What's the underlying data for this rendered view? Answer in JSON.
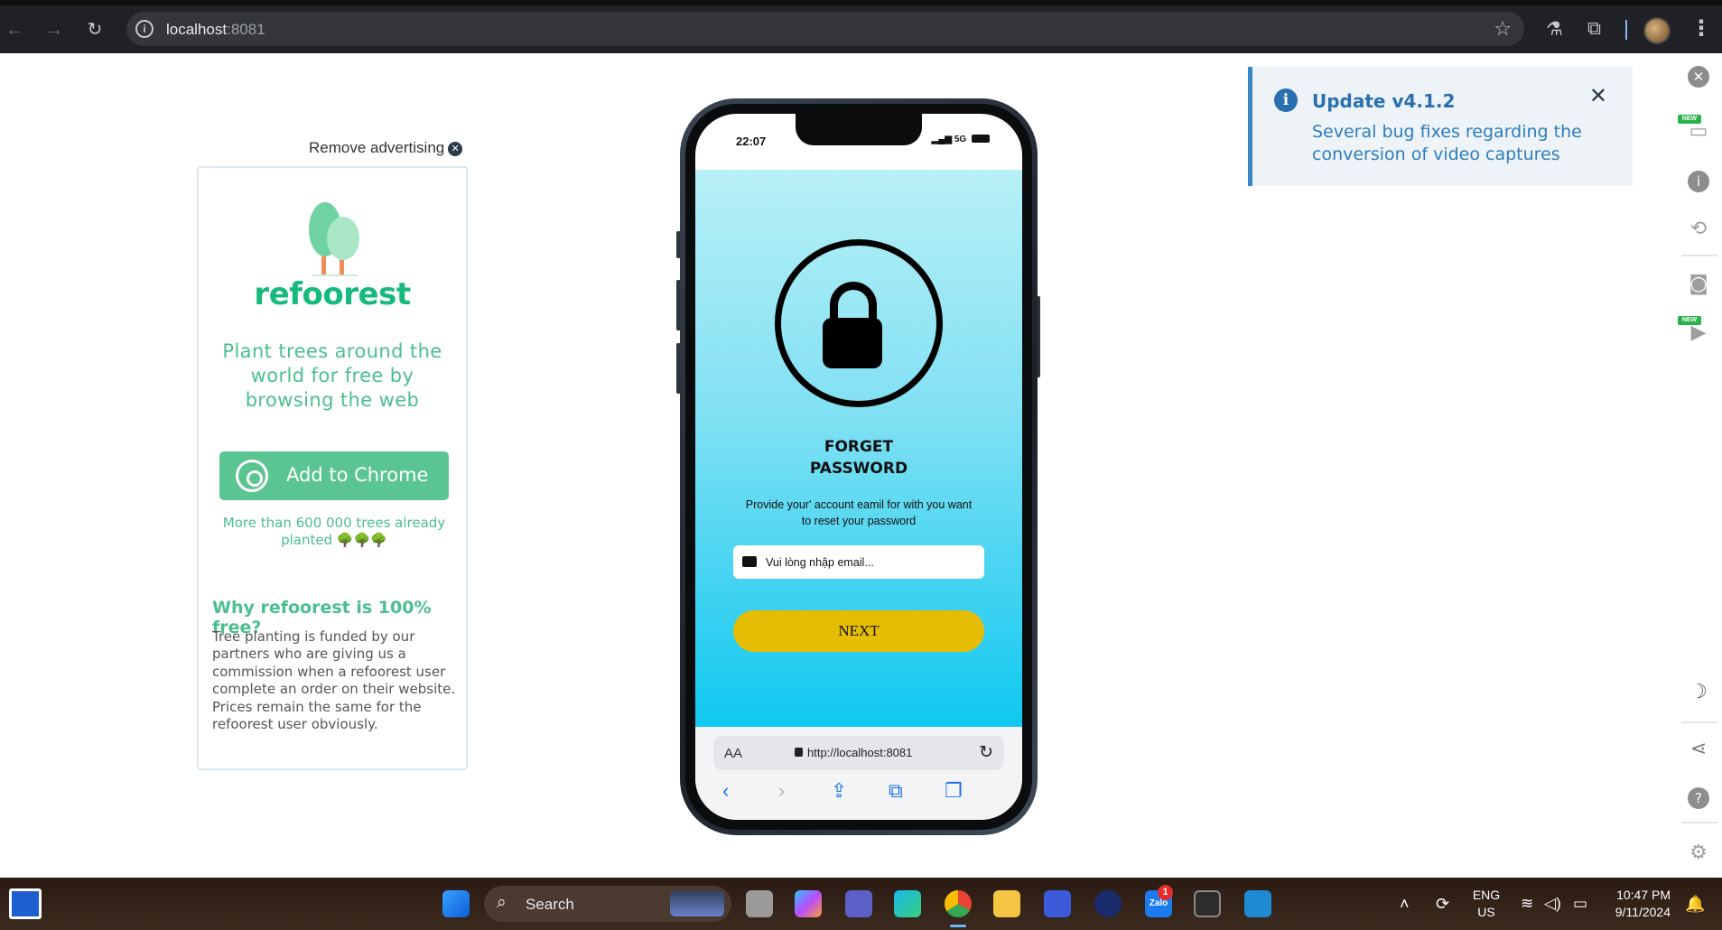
{
  "browser": {
    "url_host": "localhost",
    "url_port": ":8081",
    "icons": {
      "back": "arrow-left-icon",
      "forward": "arrow-right-icon",
      "reload": "reload-icon",
      "site_info": "info-icon",
      "bookmark": "star-icon",
      "extension_a": "flask-extension-icon",
      "extensions": "puzzle-icon",
      "menu": "kebab-menu-icon"
    }
  },
  "ad": {
    "remove_label": "Remove advertising",
    "brand": "refoorest",
    "headline": "Plant trees around the world for free by browsing the web",
    "cta_label": "Add to Chrome",
    "planted_text": "More than 600 000 trees already planted 🌳🌳🌳",
    "why_title": "Why refoorest is 100% free?",
    "why_body": "Tree planting is funded by our partners who are giving us a commission when a refoorest user complete an order on their website. Prices remain the same for the refoorest user obviously.",
    "brand_color": "#17b97f"
  },
  "phone": {
    "status_time": "22:07",
    "status_network": "5G",
    "title_line1": "FORGET",
    "title_line2": "PASSWORD",
    "description": "Provide your' account eamil for with you want to reset your password",
    "email_placeholder": "Vui lòng nhập email...",
    "next_label": "NEXT",
    "safari_aa": "AA",
    "safari_url": "http://localhost:8081",
    "accent_button_color": "#e5bd05"
  },
  "update_notice": {
    "title": "Update v4.1.2",
    "body": "Several bug fixes regarding the conversion of video captures"
  },
  "sidebar_tools": {
    "new_badge": "NEW",
    "items": [
      "close-icon",
      "device-switch-icon",
      "info-icon",
      "rotate-icon",
      "camera-icon",
      "video-icon",
      "moon-icon",
      "share-icon",
      "help-icon",
      "settings-icon"
    ]
  },
  "taskbar": {
    "search_label": "Search",
    "lang_line1": "ENG",
    "lang_line2": "US",
    "time": "10:47 PM",
    "date": "9/11/2024",
    "zalo_badge": "1",
    "zalo_label": "Zalo"
  }
}
